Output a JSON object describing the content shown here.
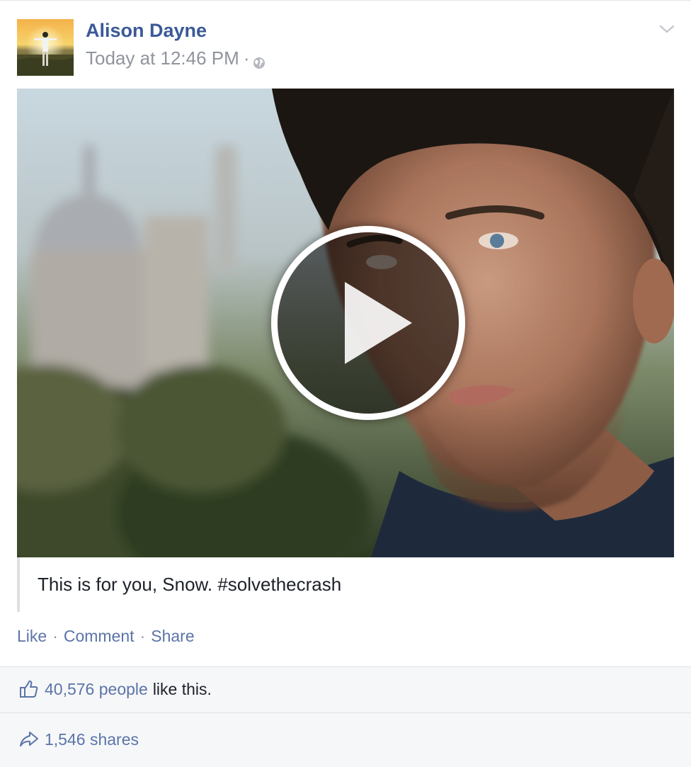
{
  "post": {
    "author": "Alison Dayne",
    "timestamp": "Today at 12:46 PM",
    "separator": "·",
    "privacy_icon": "globe-icon",
    "options_icon": "chevron-down-icon"
  },
  "video": {
    "play_icon": "play-icon"
  },
  "caption": {
    "text": "This is for you, Snow. #solvethecrash"
  },
  "actions": {
    "like": "Like",
    "comment": "Comment",
    "share": "Share",
    "separator": "·"
  },
  "summary": {
    "likes_count": "40,576 people",
    "likes_suffix": "like this.",
    "shares": "1,546 shares",
    "like_icon": "thumbs-up-icon",
    "share_icon": "share-arrow-icon"
  },
  "colors": {
    "link": "#3b5998",
    "muted": "#90949c",
    "summary_bg": "#f6f7f9"
  }
}
